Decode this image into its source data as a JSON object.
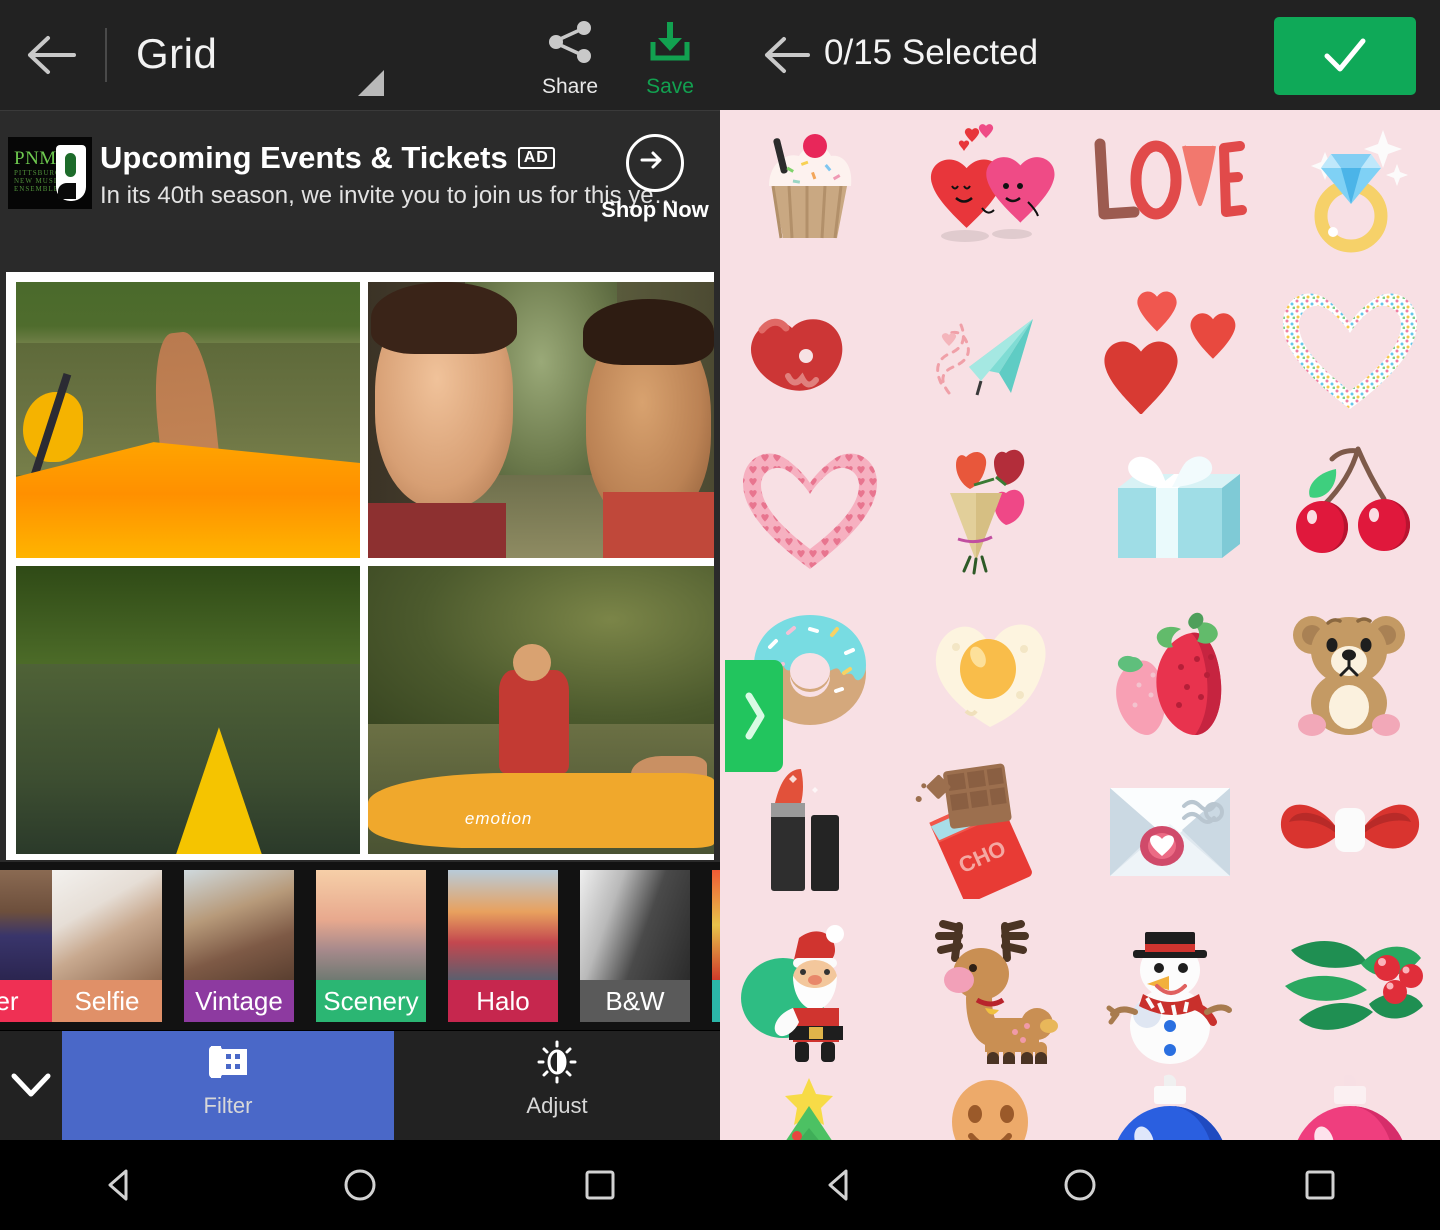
{
  "editor": {
    "back_label": "back-arrow",
    "title": "Grid",
    "share_label": "Share",
    "save_label": "Save",
    "accent_green": "#12a150",
    "accent_blue": "#4a68c8"
  },
  "ad": {
    "logo_name": "PNME",
    "logo_sub": "PITTSBURGH\nNEW MUSIC\nENSEMBLE",
    "headline": "Upcoming Events & Tickets",
    "badge": "AD",
    "description": "In its 40th season, we invite you to join us for this ye…",
    "cta_label": "Shop Now"
  },
  "filters": [
    {
      "label": "er",
      "swatch": "#ef3054",
      "thumb": "hearts"
    },
    {
      "label": "Selfie",
      "swatch": "#e09068",
      "thumb": "selfie"
    },
    {
      "label": "Vintage",
      "swatch": "#8d3aa0",
      "thumb": "vintage"
    },
    {
      "label": "Scenery",
      "swatch": "#2bb673",
      "thumb": "scenery"
    },
    {
      "label": "Halo",
      "swatch": "#c6274e",
      "thumb": "halo"
    },
    {
      "label": "B&W",
      "swatch": "#5a5a5a",
      "thumb": "bw"
    },
    {
      "label": "",
      "swatch": "#2bb6a8",
      "thumb": "warm"
    }
  ],
  "bottom_tabs": [
    {
      "label": "Filter",
      "icon": "film-roll-icon",
      "active": true
    },
    {
      "label": "Adjust",
      "icon": "brightness-icon",
      "active": false
    }
  ],
  "collapse_icon": "chevron-down-icon",
  "stickers_panel": {
    "back_label": "back-arrow",
    "selection_count": "0/15 Selected",
    "confirm_icon": "checkmark-icon",
    "confirm_color": "#0fa958",
    "background": "#f8e0e4",
    "drawer_tab_icon": "chevron-right-icon",
    "drawer_tab_color": "#22c55e",
    "items": [
      "cupcake-sticker",
      "two-hearts-characters-sticker",
      "love-text-sticker",
      "diamond-ring-sticker",
      "kiss-lips-sticker",
      "paper-plane-sticker",
      "three-hearts-sticker",
      "dotted-heart-frame-sticker",
      "heart-outline-frame-sticker",
      "flower-bouquet-sticker",
      "gift-box-sticker",
      "cherries-sticker",
      "donut-sticker",
      "heart-fried-egg-sticker",
      "strawberries-sticker",
      "teddy-bear-sticker",
      "lipstick-sticker",
      "chocolate-bar-sticker",
      "love-letter-envelope-sticker",
      "red-bow-sticker",
      "santa-claus-sticker",
      "reindeer-sticker",
      "snowman-sticker",
      "holly-berries-sticker",
      "christmas-tree-sticker",
      "gingerbread-man-sticker",
      "blue-ornament-sticker",
      "pink-ornament-sticker"
    ]
  },
  "navbar": {
    "buttons": [
      "back-nav-icon",
      "home-nav-icon",
      "recents-nav-icon"
    ]
  }
}
